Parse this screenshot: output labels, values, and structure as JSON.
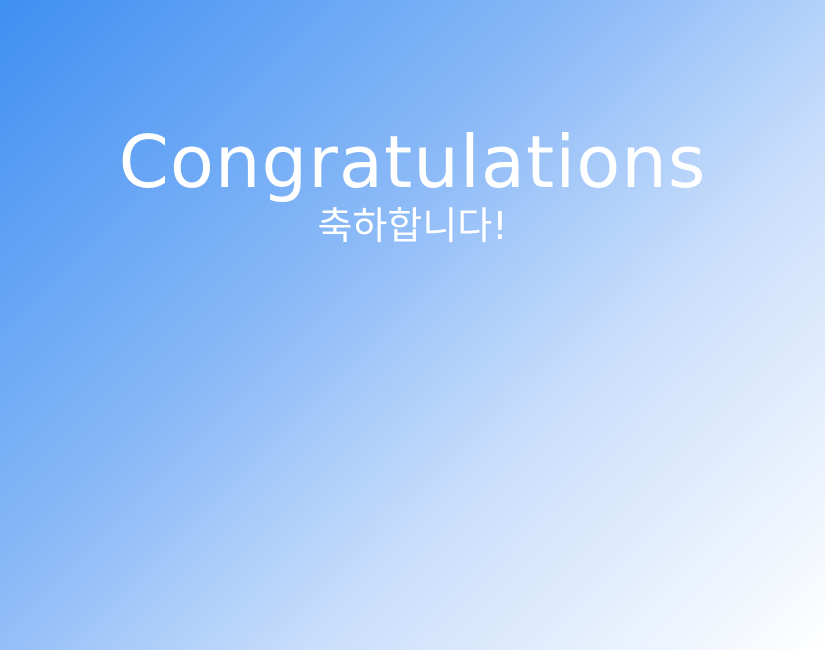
{
  "screen": {
    "background_colors": [
      "#3f8ff2",
      "#8ab9f7",
      "#c9defb",
      "#ffffff"
    ],
    "title": "Congratulations",
    "subtitle": "축하합니다!"
  }
}
